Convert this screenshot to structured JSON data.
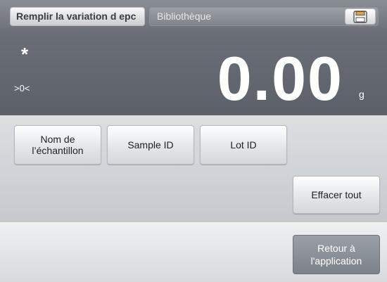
{
  "topbar": {
    "app_title": "Remplir la variation d epc",
    "library_label": "Bibliothèque",
    "save_icon": "save-icon"
  },
  "display": {
    "stable_indicator": "*",
    "zero_indicator": ">0<",
    "weight": "0.00",
    "unit": "g"
  },
  "buttons": {
    "sample_name": "Nom de l’échantillon",
    "sample_id": "Sample ID",
    "lot_id": "Lot ID",
    "clear_all": "Effacer tout",
    "return_to_app": "Retour à l'application"
  },
  "colors": {
    "display_bg": "#5c6169",
    "button_bg": "#e4e6e9",
    "return_button_bg": "#7c828a"
  }
}
